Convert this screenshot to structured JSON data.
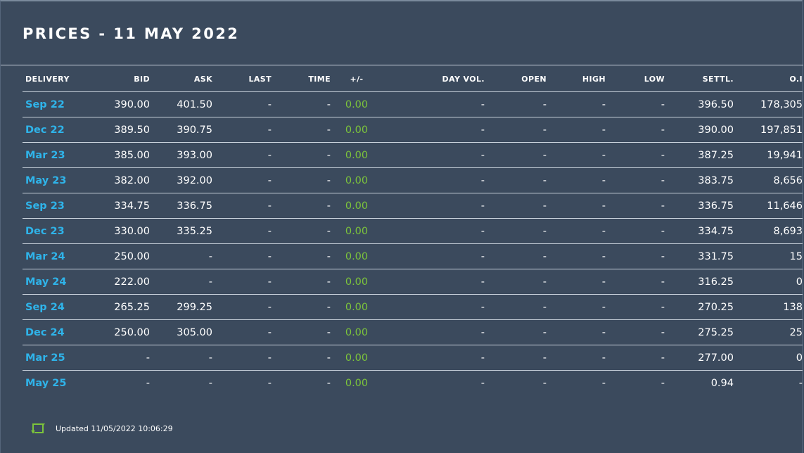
{
  "title": "PRICES - 11 MAY 2022",
  "columns": [
    "DELIVERY",
    "BID",
    "ASK",
    "LAST",
    "TIME",
    "+/-",
    "DAY VOL.",
    "OPEN",
    "HIGH",
    "LOW",
    "SETTL.",
    "O.I"
  ],
  "rows": [
    {
      "delivery": "Sep 22",
      "bid": "390.00",
      "ask": "401.50",
      "last": "-",
      "time": "-",
      "change": "0.00",
      "day_vol": "-",
      "open": "-",
      "high": "-",
      "low": "-",
      "settl": "396.50",
      "oi": "178,305"
    },
    {
      "delivery": "Dec 22",
      "bid": "389.50",
      "ask": "390.75",
      "last": "-",
      "time": "-",
      "change": "0.00",
      "day_vol": "-",
      "open": "-",
      "high": "-",
      "low": "-",
      "settl": "390.00",
      "oi": "197,851"
    },
    {
      "delivery": "Mar 23",
      "bid": "385.00",
      "ask": "393.00",
      "last": "-",
      "time": "-",
      "change": "0.00",
      "day_vol": "-",
      "open": "-",
      "high": "-",
      "low": "-",
      "settl": "387.25",
      "oi": "19,941"
    },
    {
      "delivery": "May 23",
      "bid": "382.00",
      "ask": "392.00",
      "last": "-",
      "time": "-",
      "change": "0.00",
      "day_vol": "-",
      "open": "-",
      "high": "-",
      "low": "-",
      "settl": "383.75",
      "oi": "8,656"
    },
    {
      "delivery": "Sep 23",
      "bid": "334.75",
      "ask": "336.75",
      "last": "-",
      "time": "-",
      "change": "0.00",
      "day_vol": "-",
      "open": "-",
      "high": "-",
      "low": "-",
      "settl": "336.75",
      "oi": "11,646"
    },
    {
      "delivery": "Dec 23",
      "bid": "330.00",
      "ask": "335.25",
      "last": "-",
      "time": "-",
      "change": "0.00",
      "day_vol": "-",
      "open": "-",
      "high": "-",
      "low": "-",
      "settl": "334.75",
      "oi": "8,693"
    },
    {
      "delivery": "Mar 24",
      "bid": "250.00",
      "ask": "-",
      "last": "-",
      "time": "-",
      "change": "0.00",
      "day_vol": "-",
      "open": "-",
      "high": "-",
      "low": "-",
      "settl": "331.75",
      "oi": "15"
    },
    {
      "delivery": "May 24",
      "bid": "222.00",
      "ask": "-",
      "last": "-",
      "time": "-",
      "change": "0.00",
      "day_vol": "-",
      "open": "-",
      "high": "-",
      "low": "-",
      "settl": "316.25",
      "oi": "0"
    },
    {
      "delivery": "Sep 24",
      "bid": "265.25",
      "ask": "299.25",
      "last": "-",
      "time": "-",
      "change": "0.00",
      "day_vol": "-",
      "open": "-",
      "high": "-",
      "low": "-",
      "settl": "270.25",
      "oi": "138"
    },
    {
      "delivery": "Dec 24",
      "bid": "250.00",
      "ask": "305.00",
      "last": "-",
      "time": "-",
      "change": "0.00",
      "day_vol": "-",
      "open": "-",
      "high": "-",
      "low": "-",
      "settl": "275.25",
      "oi": "25"
    },
    {
      "delivery": "Mar 25",
      "bid": "-",
      "ask": "-",
      "last": "-",
      "time": "-",
      "change": "0.00",
      "day_vol": "-",
      "open": "-",
      "high": "-",
      "low": "-",
      "settl": "277.00",
      "oi": "0"
    },
    {
      "delivery": "May 25",
      "bid": "-",
      "ask": "-",
      "last": "-",
      "time": "-",
      "change": "0.00",
      "day_vol": "-",
      "open": "-",
      "high": "-",
      "low": "-",
      "settl": "0.94",
      "oi": "-"
    }
  ],
  "footer": {
    "updated_text": "Updated 11/05/2022 10:06:29",
    "icon": "refresh-icon"
  },
  "colors": {
    "background": "#3b4a5d",
    "delivery_link": "#2fb4ea",
    "change_positive": "#7cc43b",
    "rule": "#c9d2dc"
  }
}
